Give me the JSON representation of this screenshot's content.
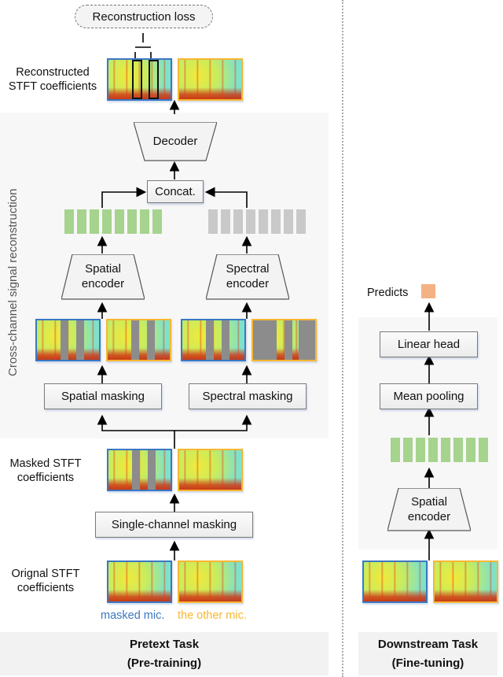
{
  "left": {
    "loss_label": "Reconstruction loss",
    "reconstructed_label": "Reconstructed\nSTFT coefficients",
    "panel_label": "Cross-channel signal reconstruction",
    "decoder_label": "Decoder",
    "concat_label": "Concat.",
    "spatial_encoder_label": "Spatial\nencoder",
    "spectral_encoder_label": "Spectral\nencoder",
    "spatial_masking_label": "Spatial masking",
    "spectral_masking_label": "Spectral masking",
    "masked_label": "Masked STFT\ncoefficients",
    "single_masking_label": "Single-channel masking",
    "original_label": "Orignal STFT\ncoefficients",
    "legend_masked": "masked mic.",
    "legend_other": "the other mic.",
    "footer_line1": "Pretext Task",
    "footer_line2": "(Pre-training)"
  },
  "right": {
    "predicts_label": "Predicts",
    "linear_head_label": "Linear head",
    "mean_pooling_label": "Mean pooling",
    "spatial_encoder_label": "Spatial\nencoder",
    "footer_line1": "Downstream Task",
    "footer_line2": "(Fine-tuning)"
  },
  "colors": {
    "masked_mic": "#3a78c2",
    "other_mic": "#f7b731",
    "spatial_token": "#a6d38d",
    "spectral_token": "#c9c9c9",
    "prediction": "#f4b183",
    "mask": "#8c8c8c"
  }
}
